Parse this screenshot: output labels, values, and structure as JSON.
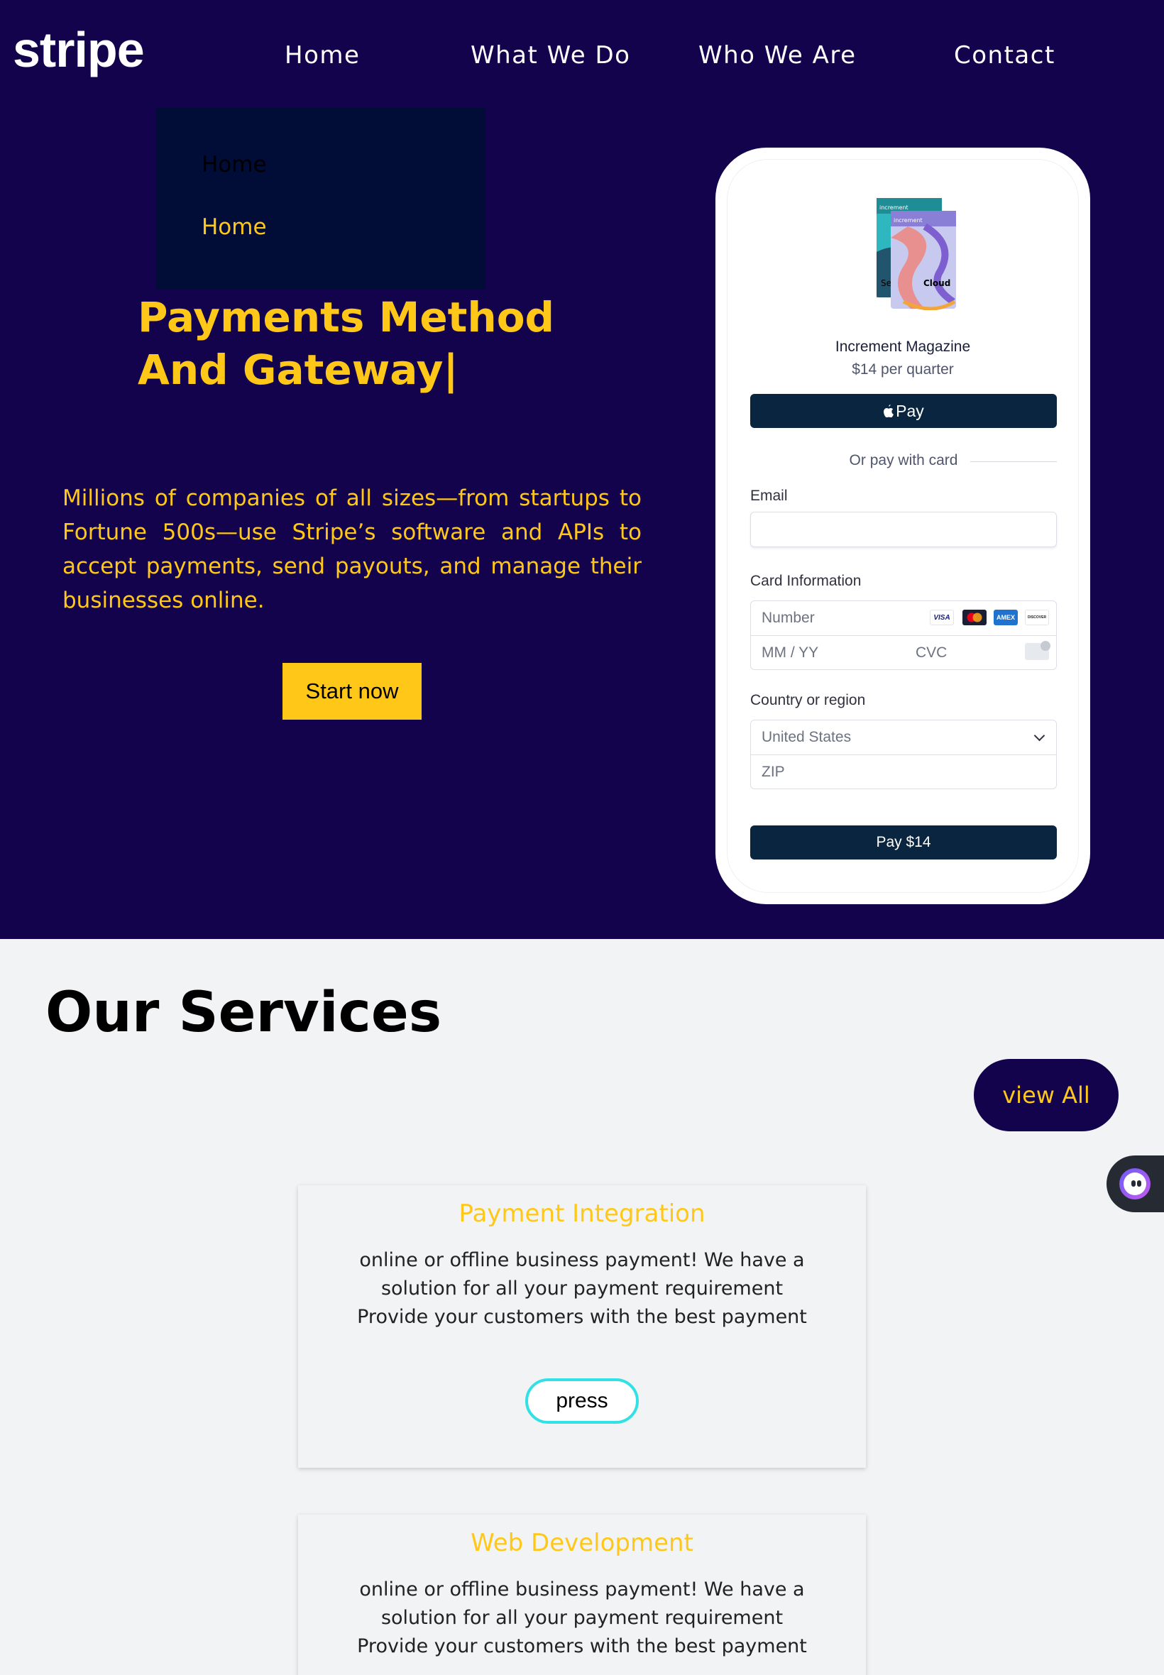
{
  "header": {
    "logo": "stripe",
    "nav": [
      "Home",
      "What We Do",
      "Who We Are",
      "Contact"
    ]
  },
  "dropdown": {
    "items": [
      "Home",
      "Home"
    ]
  },
  "hero": {
    "title": "Payments Method And Gateway|",
    "description": "Millions of companies of all sizes—from startups to Fortune 500s—use Stripe’s software and APIs to accept payments, send payouts, and manage their businesses online.",
    "cta": "Start now"
  },
  "checkout": {
    "product_name": "Increment Magazine",
    "product_price": "$14 per quarter",
    "apple_pay_label": "Pay",
    "or_text": "Or pay with card",
    "email_label": "Email",
    "email_value": "",
    "card_label": "Card Information",
    "card_number_placeholder": "Number",
    "expiry_placeholder": "MM / YY",
    "cvc_placeholder": "CVC",
    "card_brands": [
      "VISA",
      "mastercard",
      "AMEX",
      "DISCOVER"
    ],
    "country_label": "Country or region",
    "country_value": "United States",
    "zip_placeholder": "ZIP",
    "pay_button": "Pay $14",
    "book_cover_text": [
      "increment",
      "increment",
      "Se",
      "Cloud"
    ]
  },
  "colors": {
    "hero_bg": "#13034d",
    "accent": "#ffc819",
    "pay_button": "#0a2540",
    "press_border": "#32e0e6"
  },
  "services": {
    "title": "Our Services",
    "view_all": "view All",
    "cards": [
      {
        "title": "Payment Integration",
        "description": "online or offline business payment! We have a solution for all your payment requirement Provide your customers with the best payment",
        "button": "press"
      },
      {
        "title": "Web Development",
        "description": "online or offline business payment! We have a solution for all your payment requirement Provide your customers with the best payment"
      }
    ]
  }
}
